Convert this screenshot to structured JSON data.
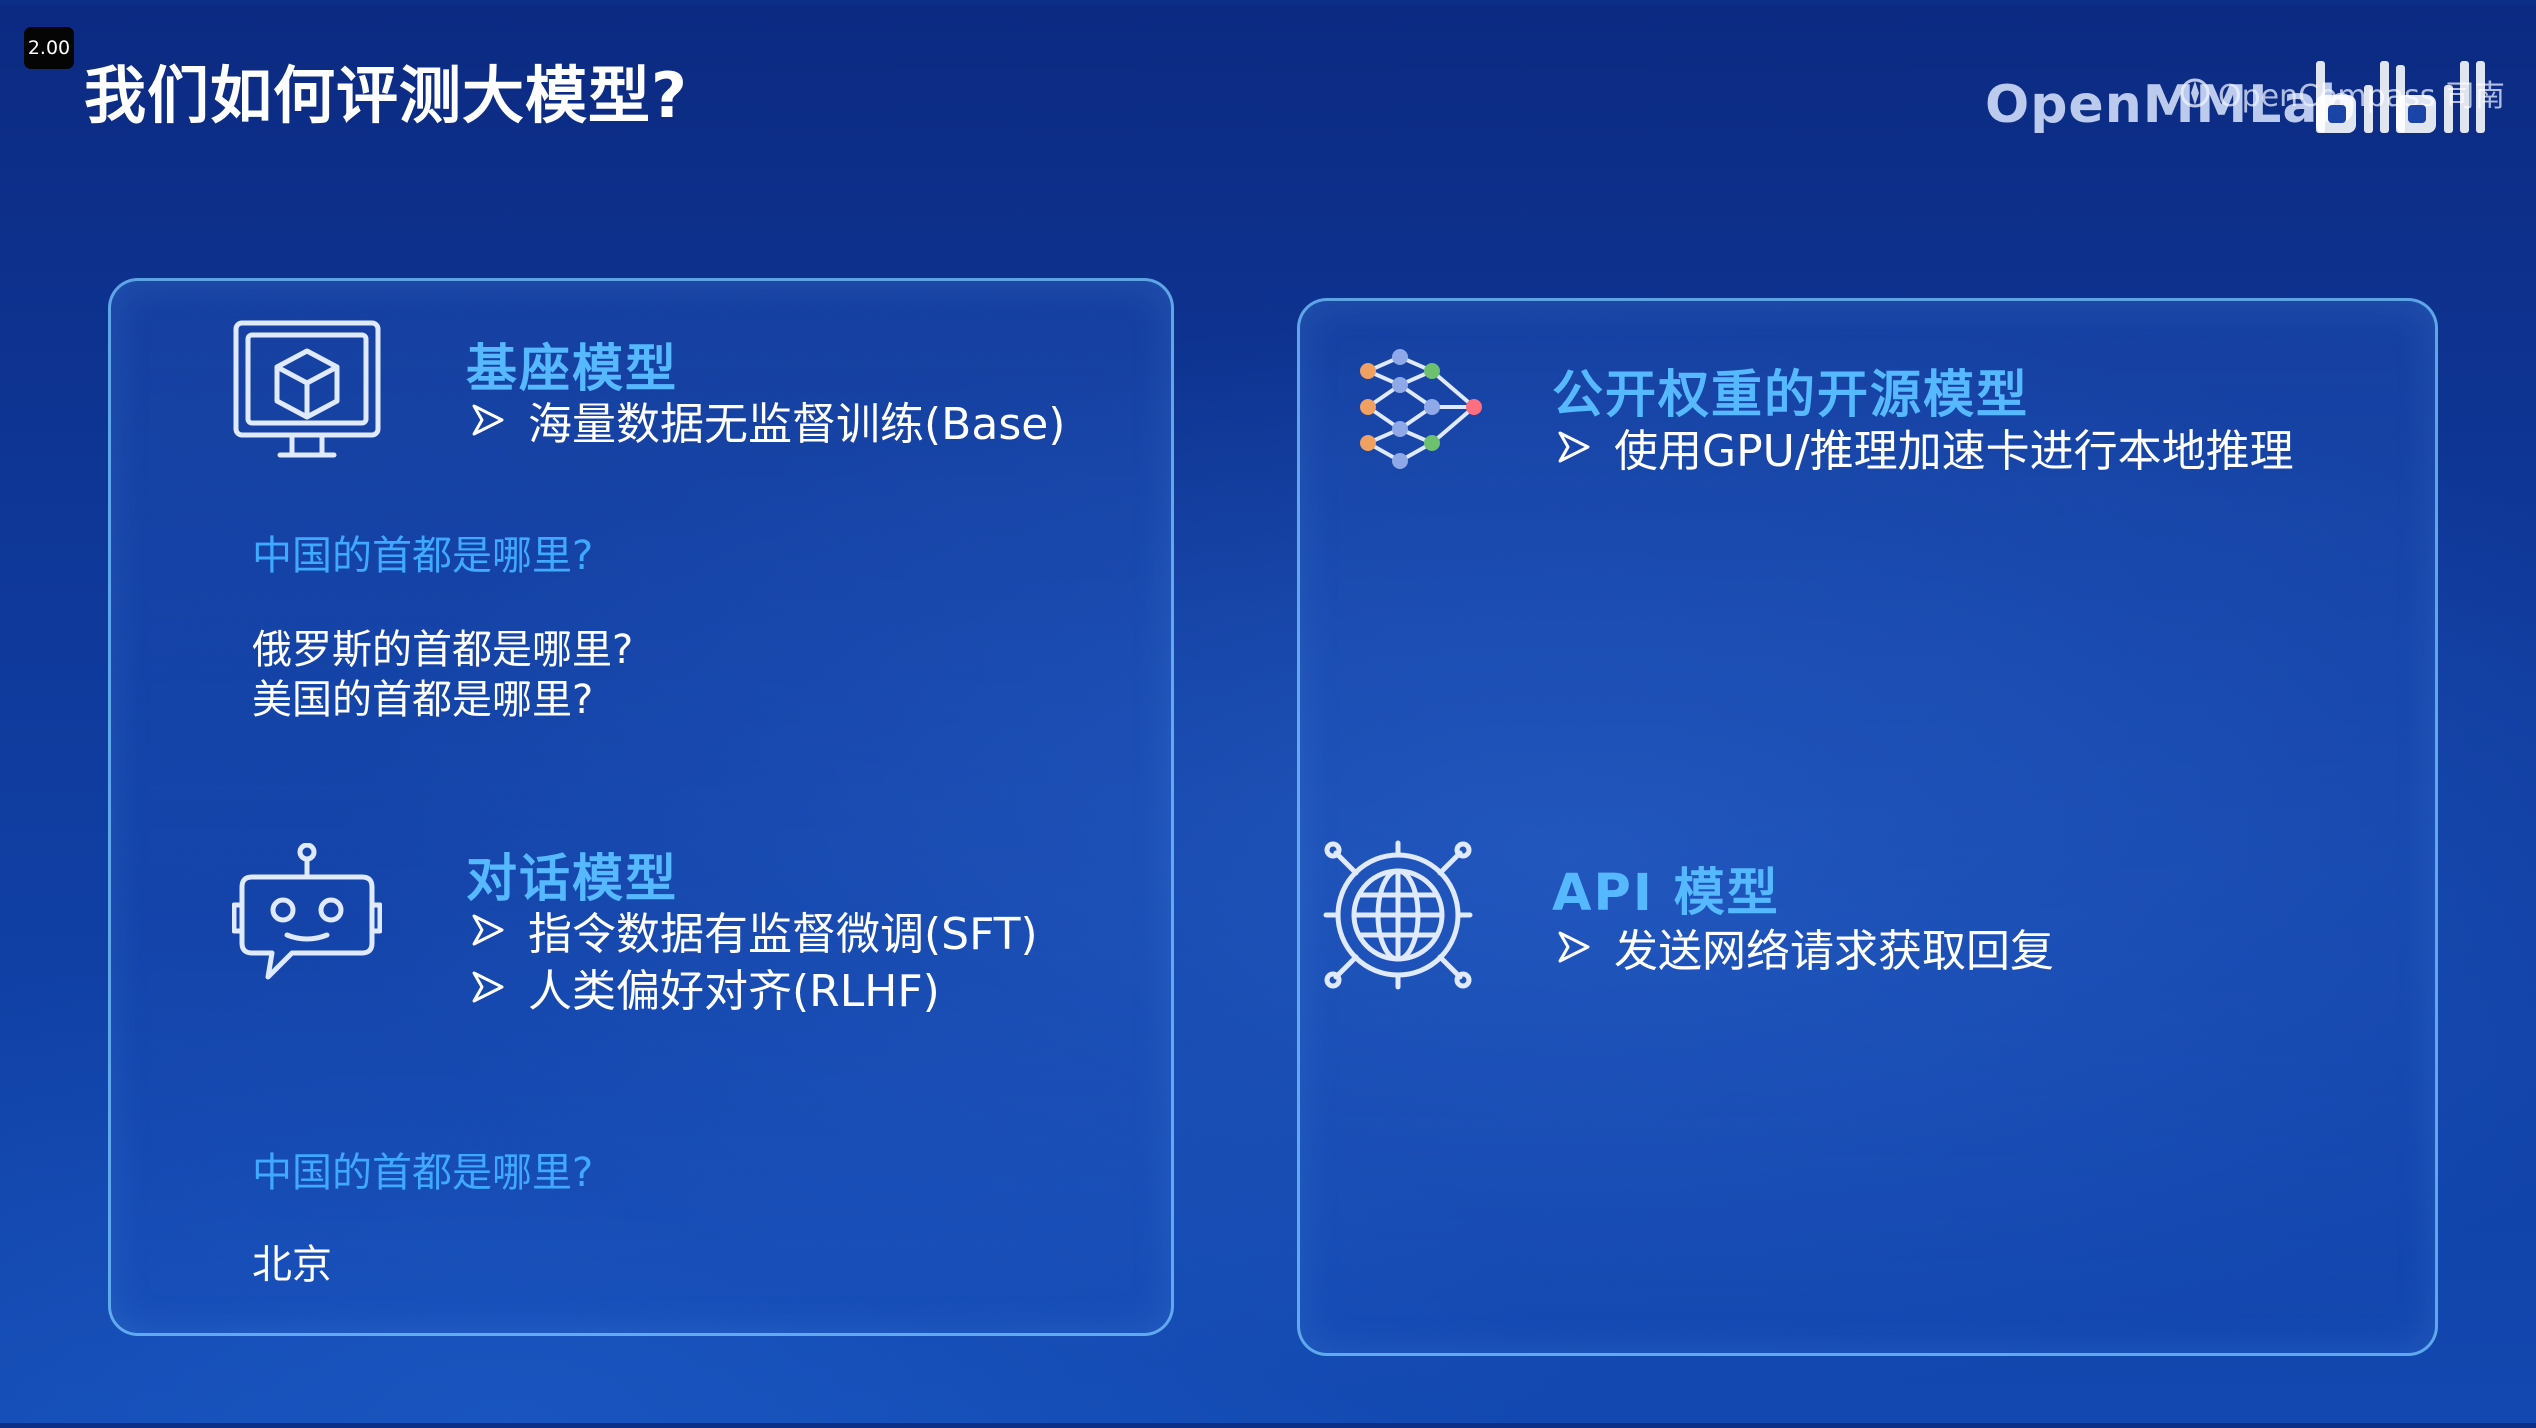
{
  "player": {
    "speed": "2.00"
  },
  "header": {
    "title": "我们如何评测大模型?",
    "brand_openmmlab": "OpenMMLab",
    "brand_opencompass": "OpenCompass 司南"
  },
  "left_panel": {
    "base_model": {
      "title": "基座模型",
      "icon": "cube-monitor-icon",
      "bullets": [
        "海量数据无监督训练(Base)"
      ],
      "prompt_question": "中国的首都是哪里?",
      "continuation": [
        "俄罗斯的首都是哪里?",
        "美国的首都是哪里?"
      ]
    },
    "chat_model": {
      "title": "对话模型",
      "icon": "robot-chat-icon",
      "bullets": [
        "指令数据有监督微调(SFT)",
        "人类偏好对齐(RLHF)"
      ],
      "prompt_question": "中国的首都是哪里?",
      "answer": "北京"
    }
  },
  "right_panel": {
    "open_weight_model": {
      "title": "公开权重的开源模型",
      "icon": "neural-network-icon",
      "bullets": [
        "使用GPU/推理加速卡进行本地推理"
      ]
    },
    "api_model": {
      "title": "API 模型",
      "icon": "globe-network-icon",
      "bullets": [
        "发送网络请求获取回复"
      ]
    }
  },
  "colors": {
    "background": "#0f3a9c",
    "heading": "#56b8ff",
    "question": "#3fa9ff",
    "panel_border": "#78c8ff"
  }
}
